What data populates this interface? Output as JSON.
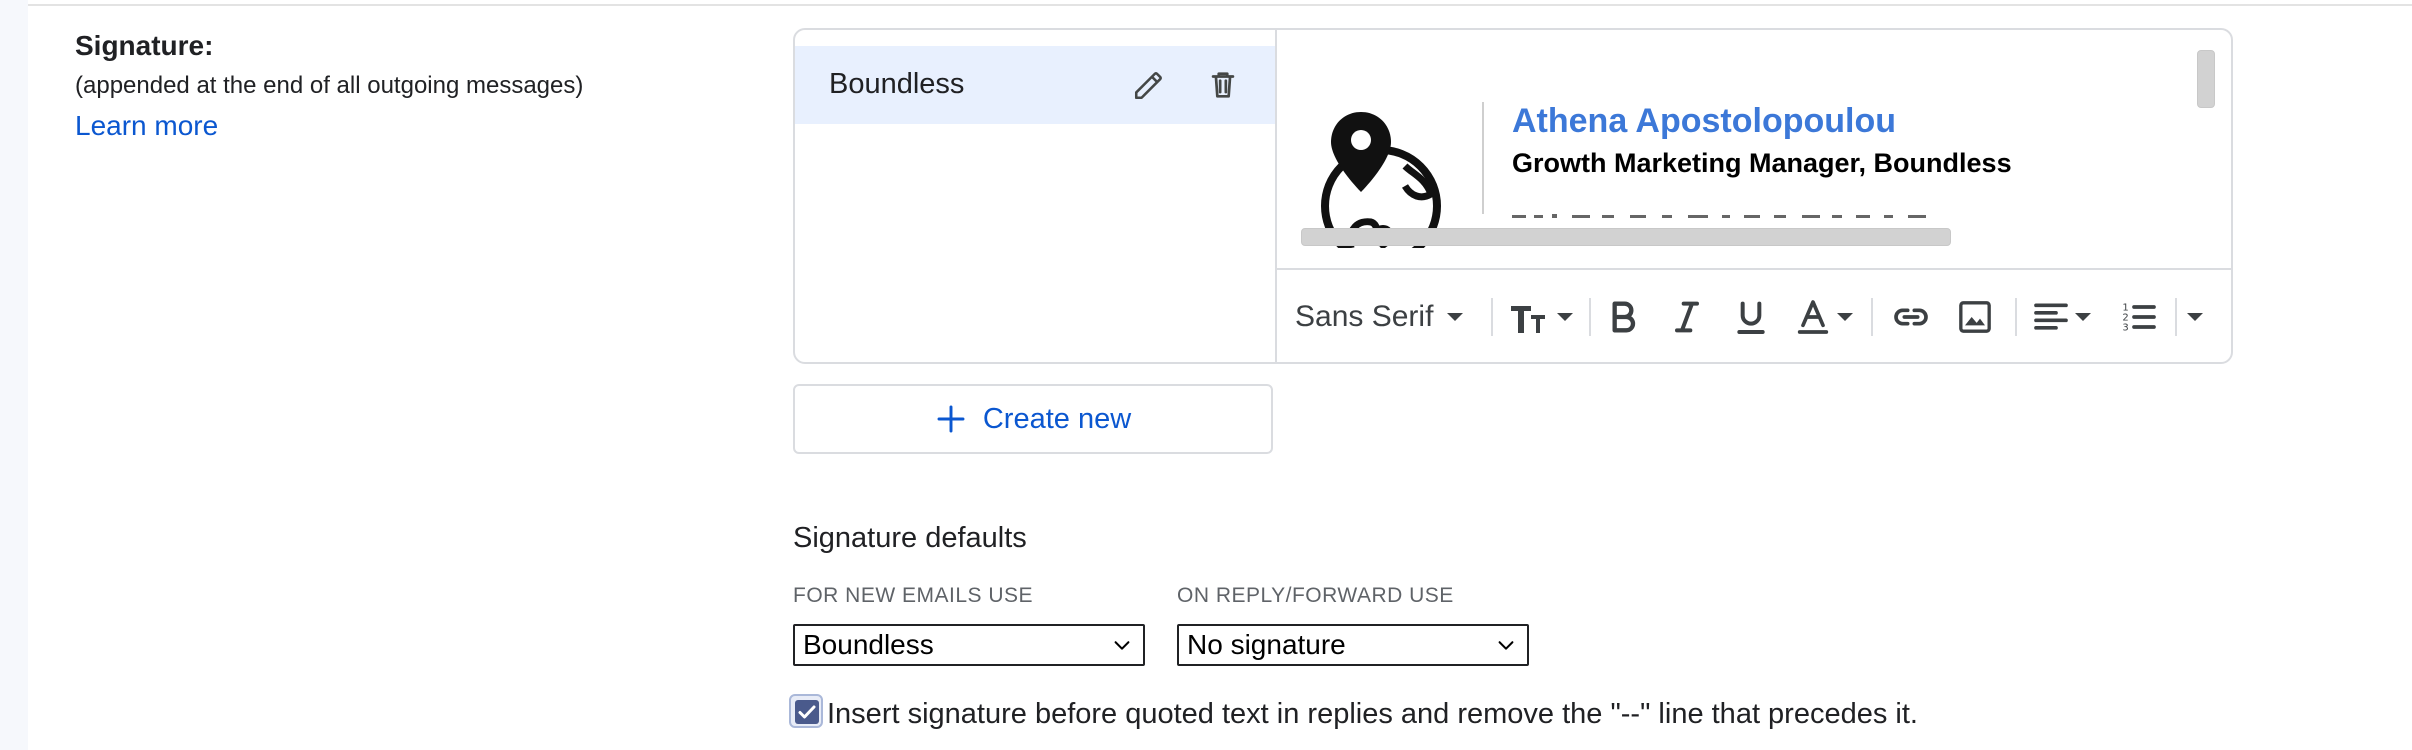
{
  "signature_section": {
    "title": "Signature:",
    "subtitle": "(appended at the end of all outgoing messages)",
    "learn_more": "Learn more"
  },
  "signature_list": {
    "items": [
      {
        "name": "Boundless",
        "selected": true
      }
    ]
  },
  "preview": {
    "name": "Athena Apostolopoulou",
    "role": "Growth Marketing Manager, Boundless",
    "logo_icon": "globe-location-pin-icon",
    "name_color": "#3c78d8"
  },
  "toolbar": {
    "font_family": "Sans Serif",
    "buttons": [
      "text-size-icon",
      "bold-icon",
      "italic-icon",
      "underline-icon",
      "text-color-icon",
      "link-icon",
      "image-icon",
      "align-icon",
      "numbered-list-icon",
      "more-formatting-icon"
    ]
  },
  "create_new": {
    "label": "Create new"
  },
  "defaults": {
    "title": "Signature defaults",
    "new_emails": {
      "label": "FOR NEW EMAILS USE",
      "value": "Boundless"
    },
    "reply_forward": {
      "label": "ON REPLY/FORWARD USE",
      "value": "No signature"
    }
  },
  "insert_option": {
    "label": "Insert signature before quoted text in replies and remove the \"--\" line that precedes it.",
    "checked": true
  },
  "colors": {
    "link": "#0b57d0",
    "selected_row": "#e8f0fe",
    "border": "#dadce0"
  }
}
